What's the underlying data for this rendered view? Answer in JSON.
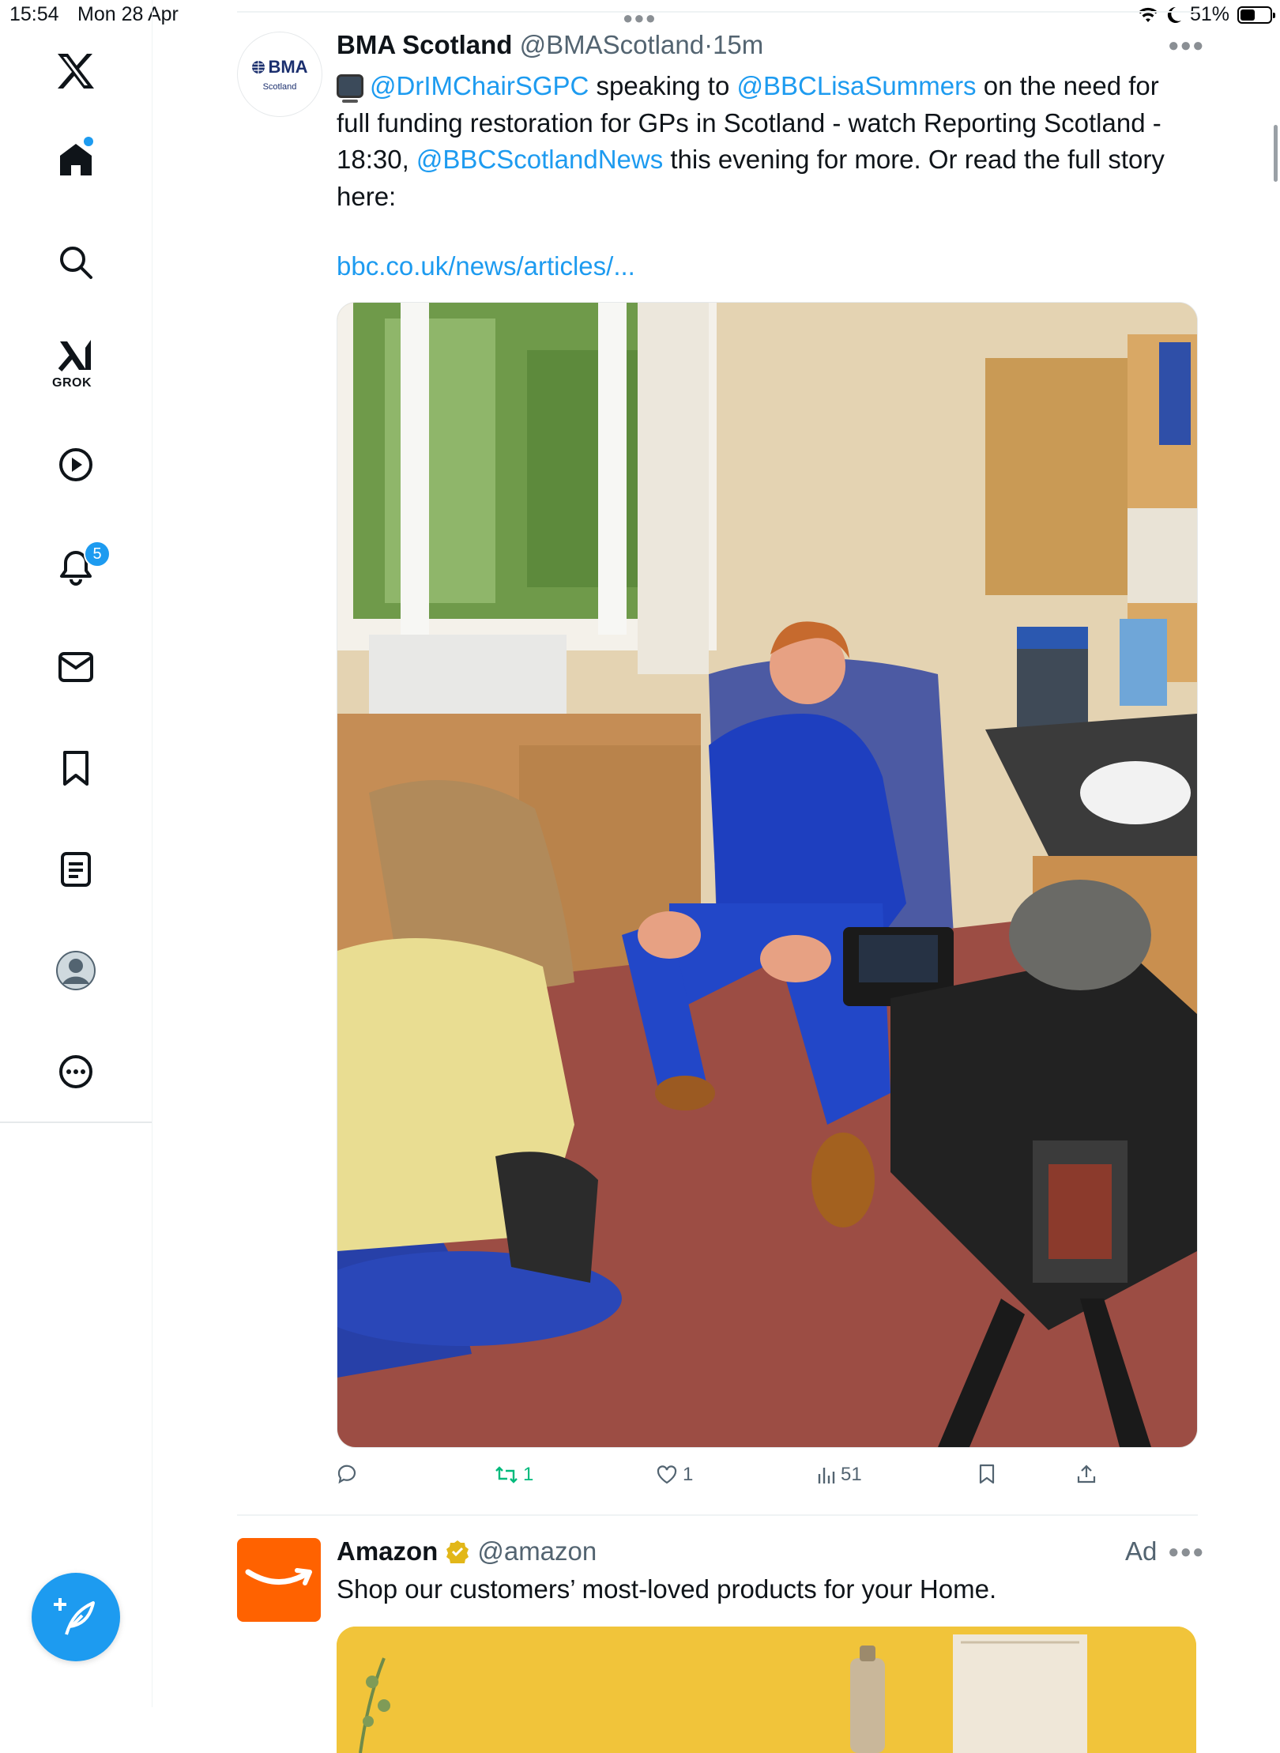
{
  "status_bar": {
    "time": "15:54",
    "date": "Mon 28 Apr",
    "battery": "51%",
    "battery_level": 0.51
  },
  "sidebar": {
    "logo": "x-logo-icon",
    "items": [
      {
        "name": "home",
        "icon": "home-icon",
        "has_dot": true
      },
      {
        "name": "explore",
        "icon": "search-icon"
      },
      {
        "name": "grok",
        "icon": "grok-icon",
        "label": "GROK"
      },
      {
        "name": "videos",
        "icon": "play-icon"
      },
      {
        "name": "notifications",
        "icon": "bell-icon",
        "badge": "5"
      },
      {
        "name": "messages",
        "icon": "mail-icon"
      },
      {
        "name": "bookmarks",
        "icon": "bookmark-icon"
      },
      {
        "name": "lists",
        "icon": "list-icon"
      },
      {
        "name": "profile",
        "icon": "avatar-icon"
      },
      {
        "name": "more",
        "icon": "more-circle-icon"
      }
    ],
    "compose_icon": "compose-icon",
    "accent": "#1d9bf0"
  },
  "tweet": {
    "avatar_text": "BMA",
    "avatar_subtext": "Scotland",
    "display_name": "BMA Scotland",
    "handle": "@BMAScotland",
    "separator": "·",
    "time": "15m",
    "text": {
      "mention1": "@DrIMChairSGPC",
      "part1": " speaking to ",
      "mention2": "@BBCLisaSummers",
      "part2": " on the need for full funding restoration for GPs in Scotland - watch Reporting Scotland - 18:30, ",
      "mention3": "@BBCScotlandNews",
      "part3": " this evening for more. Or read the full story here:"
    },
    "url": "bbc.co.uk/news/articles/...",
    "actions": {
      "replies": "",
      "retweets": "1",
      "likes": "1",
      "views": "51"
    }
  },
  "ad": {
    "display_name": "Amazon",
    "handle": "@amazon",
    "label": "Ad",
    "text": "Shop our customers’ most-loved products for your Home.",
    "brand_color": "#ff6200"
  }
}
